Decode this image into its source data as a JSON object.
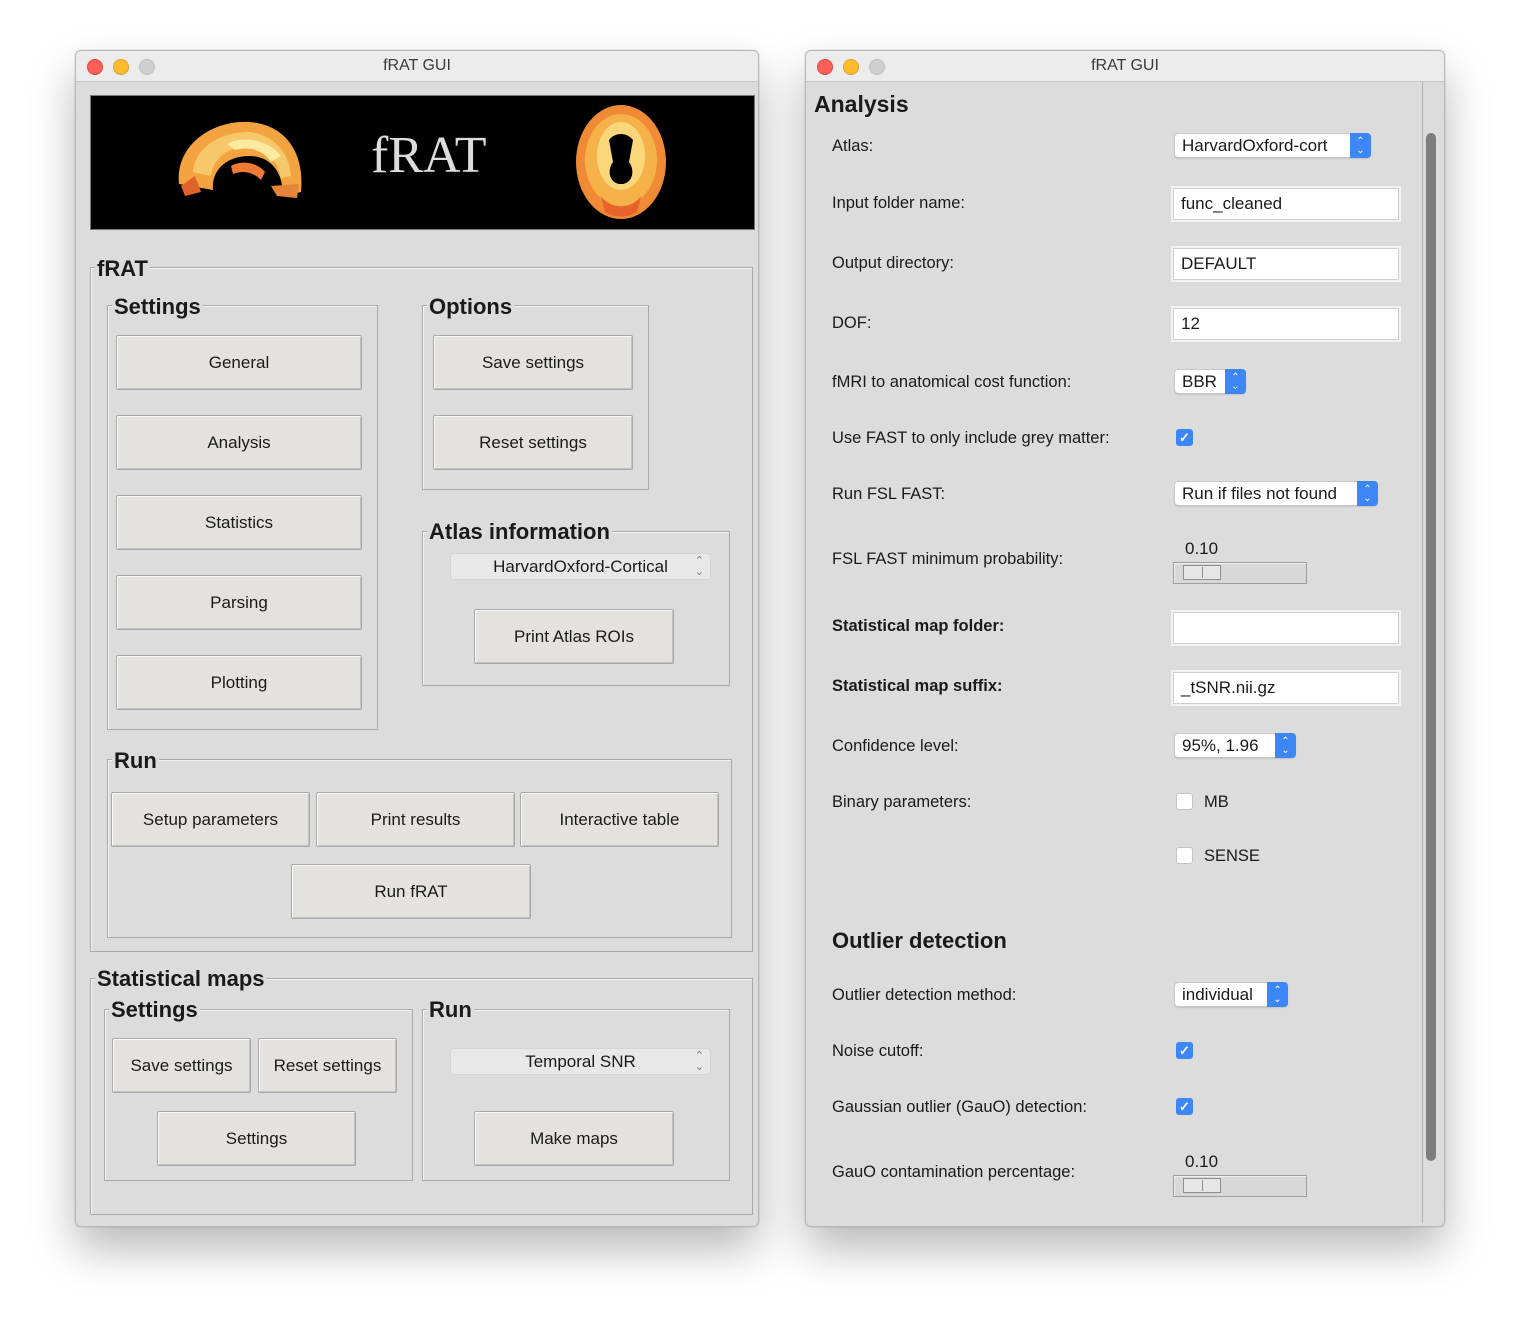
{
  "left_window": {
    "title": "fRAT GUI",
    "banner_text": "fRAT",
    "frat_group": {
      "title": "fRAT",
      "settings": {
        "title": "Settings",
        "buttons": [
          "General",
          "Analysis",
          "Statistics",
          "Parsing",
          "Plotting"
        ]
      },
      "options": {
        "title": "Options",
        "save": "Save settings",
        "reset": "Reset settings"
      },
      "atlas": {
        "title": "Atlas information",
        "selected": "HarvardOxford-Cortical",
        "print": "Print Atlas ROIs"
      },
      "run": {
        "title": "Run",
        "setup": "Setup parameters",
        "print": "Print results",
        "table": "Interactive table",
        "run": "Run fRAT"
      }
    },
    "stat_maps": {
      "title": "Statistical maps",
      "settings": {
        "title": "Settings",
        "save": "Save settings",
        "reset": "Reset settings",
        "settings": "Settings"
      },
      "run": {
        "title": "Run",
        "selected": "Temporal SNR",
        "make": "Make maps"
      }
    }
  },
  "right_window": {
    "title": "fRAT GUI",
    "section_title": "Analysis",
    "fields": {
      "atlas_label": "Atlas:",
      "atlas_value": "HarvardOxford-cort",
      "input_folder_label": "Input folder name:",
      "input_folder_value": "func_cleaned",
      "output_dir_label": "Output directory:",
      "output_dir_value": "DEFAULT",
      "dof_label": "DOF:",
      "dof_value": "12",
      "cost_label": "fMRI to anatomical cost function:",
      "cost_value": "BBR",
      "fast_grey_label": "Use FAST to only include grey matter:",
      "fast_grey_checked": true,
      "run_fast_label": "Run FSL FAST:",
      "run_fast_value": "Run if files not found",
      "fast_prob_label": "FSL FAST minimum probability:",
      "fast_prob_value": "0.10",
      "stat_folder_label": "Statistical map folder:",
      "stat_folder_value": "",
      "stat_suffix_label": "Statistical map suffix:",
      "stat_suffix_value": "_tSNR.nii.gz",
      "confidence_label": "Confidence level:",
      "confidence_value": "95%, 1.96",
      "binary_label": "Binary parameters:",
      "binary_mb": "MB",
      "binary_mb_checked": false,
      "binary_sense": "SENSE",
      "binary_sense_checked": false
    },
    "outlier": {
      "title": "Outlier detection",
      "method_label": "Outlier detection method:",
      "method_value": "individual",
      "noise_label": "Noise cutoff:",
      "noise_checked": true,
      "gauo_label": "Gaussian outlier (GauO) detection:",
      "gauo_checked": true,
      "contam_label": "GauO contamination percentage:",
      "contam_value": "0.10"
    }
  }
}
